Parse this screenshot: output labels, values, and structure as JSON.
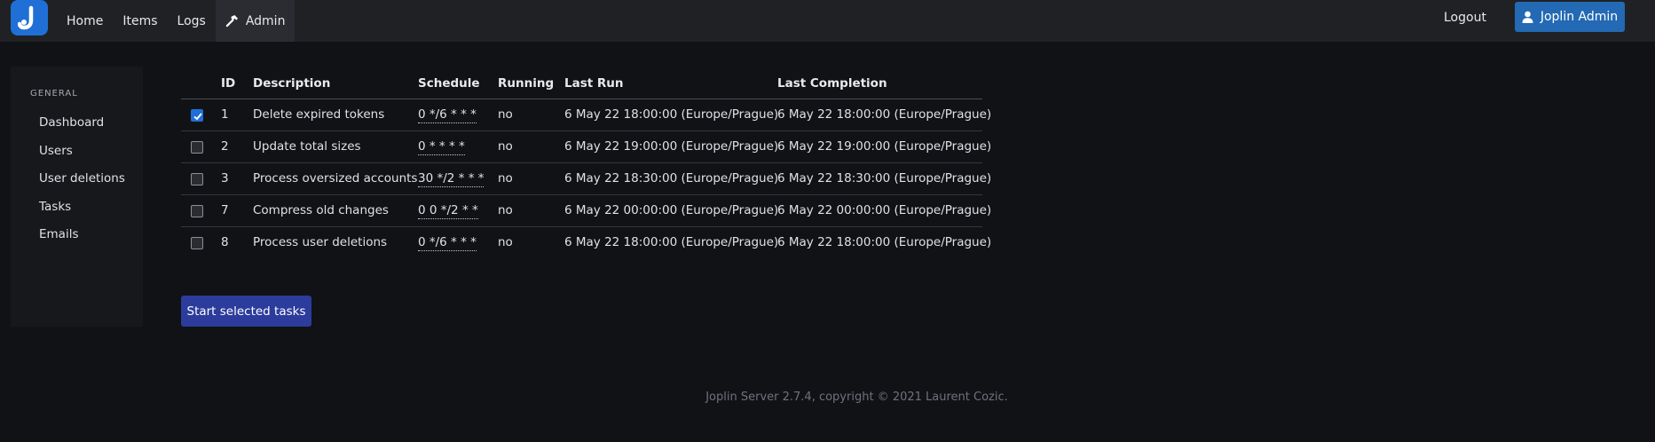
{
  "nav": {
    "items": [
      {
        "label": "Home"
      },
      {
        "label": "Items"
      },
      {
        "label": "Logs"
      },
      {
        "label": "Admin"
      }
    ],
    "logout_label": "Logout",
    "user_label": "Joplin Admin",
    "brand_color": "#1f6fd6"
  },
  "sidebar": {
    "heading": "GENERAL",
    "items": [
      {
        "label": "Dashboard"
      },
      {
        "label": "Users"
      },
      {
        "label": "User deletions"
      },
      {
        "label": "Tasks"
      },
      {
        "label": "Emails"
      }
    ]
  },
  "table": {
    "columns": [
      "ID",
      "Description",
      "Schedule",
      "Running",
      "Last Run",
      "Last Completion"
    ],
    "rows": [
      {
        "checked": true,
        "id": "1",
        "description": "Delete expired tokens",
        "schedule": "0 */6 * * *",
        "running": "no",
        "last_run": "6 May 22 18:00:00 (Europe/Prague)",
        "last_completion": "6 May 22 18:00:00 (Europe/Prague)"
      },
      {
        "checked": false,
        "id": "2",
        "description": "Update total sizes",
        "schedule": "0 * * * *",
        "running": "no",
        "last_run": "6 May 22 19:00:00 (Europe/Prague)",
        "last_completion": "6 May 22 19:00:00 (Europe/Prague)"
      },
      {
        "checked": false,
        "id": "3",
        "description": "Process oversized accounts",
        "schedule": "30 */2 * * *",
        "running": "no",
        "last_run": "6 May 22 18:30:00 (Europe/Prague)",
        "last_completion": "6 May 22 18:30:00 (Europe/Prague)"
      },
      {
        "checked": false,
        "id": "7",
        "description": "Compress old changes",
        "schedule": "0 0 */2 * *",
        "running": "no",
        "last_run": "6 May 22 00:00:00 (Europe/Prague)",
        "last_completion": "6 May 22 00:00:00 (Europe/Prague)"
      },
      {
        "checked": false,
        "id": "8",
        "description": "Process user deletions",
        "schedule": "0 */6 * * *",
        "running": "no",
        "last_run": "6 May 22 18:00:00 (Europe/Prague)",
        "last_completion": "6 May 22 18:00:00 (Europe/Prague)"
      }
    ]
  },
  "start_button_label": "Start selected tasks",
  "footer_text": "Joplin Server 2.7.4, copyright © 2021 Laurent Cozic."
}
